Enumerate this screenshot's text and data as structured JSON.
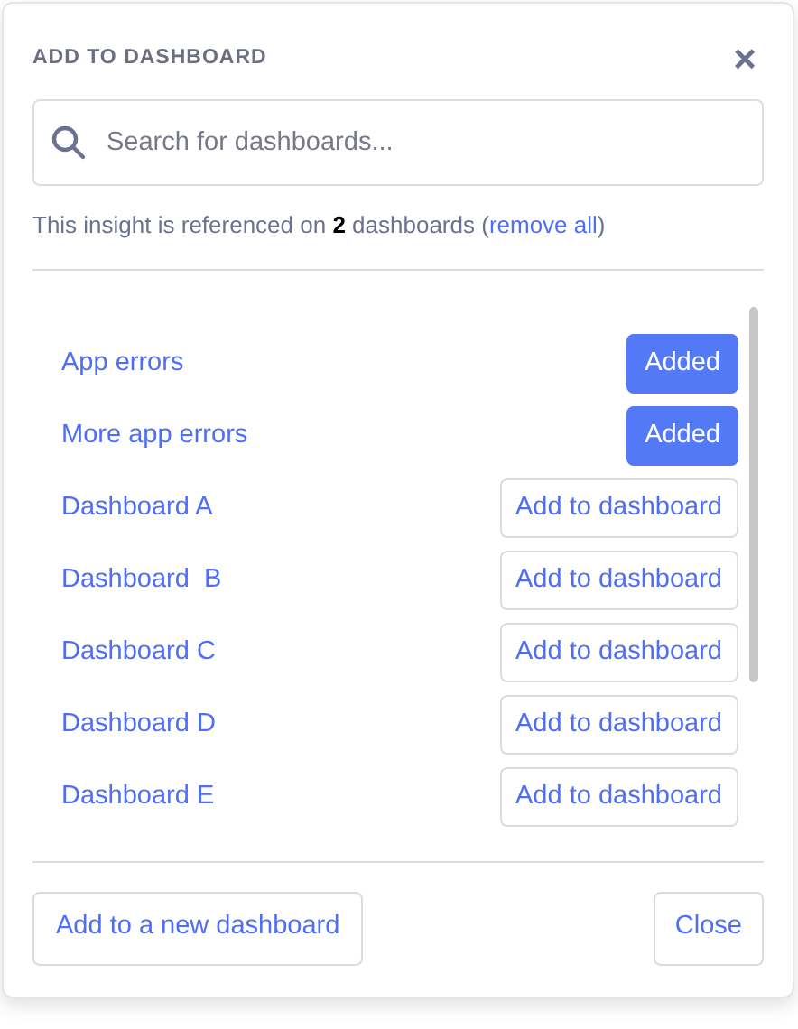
{
  "dialog": {
    "title": "ADD TO DASHBOARD",
    "close": "×"
  },
  "search": {
    "placeholder": "Search for dashboards..."
  },
  "info": {
    "text": "This insight is referenced on **2** dashboards (",
    "link": "remove all",
    "suffix": ")"
  },
  "dashboards": [
    {
      "name": "App errors",
      "added": true,
      "action": "Added"
    },
    {
      "name": "More app errors",
      "added": true,
      "action": "Added"
    },
    {
      "name": "Dashboard A",
      "added": false,
      "action": "Add to dashboard"
    },
    {
      "name": "Dashboard  B",
      "added": false,
      "action": "Add to dashboard"
    },
    {
      "name": "Dashboard C",
      "added": false,
      "action": "Add to dashboard"
    },
    {
      "name": "Dashboard D",
      "added": false,
      "action": "Add to dashboard"
    },
    {
      "name": "Dashboard E",
      "added": false,
      "action": "Add to dashboard"
    }
  ],
  "footer": {
    "new_button": "Add to a new dashboard",
    "close_button": "Close"
  }
}
